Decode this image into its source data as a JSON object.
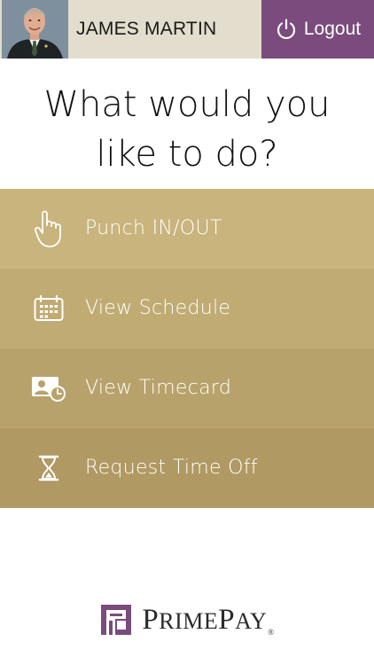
{
  "header": {
    "user_name": "JAMES MARTIN",
    "logout_label": "Logout",
    "colors": {
      "user_bg": "#e3ddcd",
      "logout_bg": "#7a4b7c"
    }
  },
  "prompt": {
    "line1": "What would you",
    "line2": "like to do?"
  },
  "menu": {
    "items": [
      {
        "label": "Punch IN/OUT",
        "icon": "hand-pointer-icon",
        "color": "#c8b47c"
      },
      {
        "label": "View Schedule",
        "icon": "calendar-icon",
        "color": "#c0ab73"
      },
      {
        "label": "View Timecard",
        "icon": "timecard-icon",
        "color": "#b8a26b"
      },
      {
        "label": "Request Time Off",
        "icon": "hourglass-icon",
        "color": "#b09962"
      }
    ]
  },
  "logo": {
    "text_p1": "P",
    "text_p2": "RIME",
    "text_p3": "P",
    "text_p4": "AY",
    "registered": "®",
    "mark_color": "#7a4b7c"
  }
}
